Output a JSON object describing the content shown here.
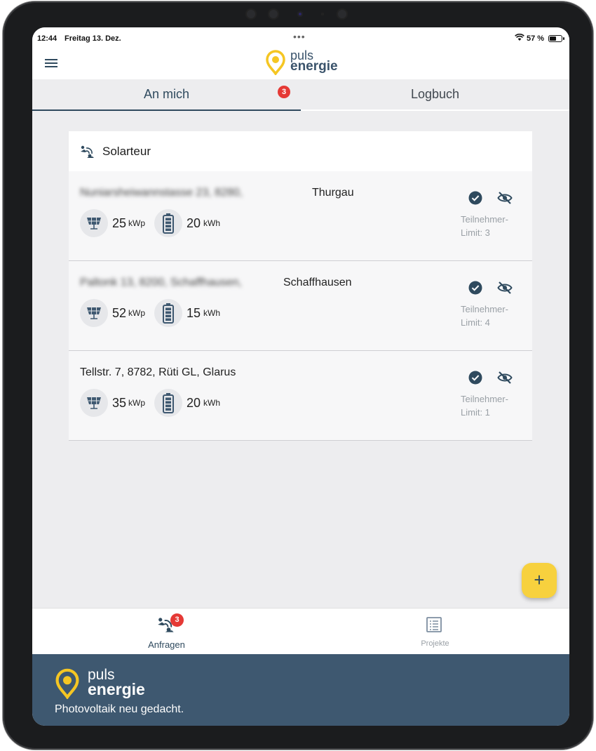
{
  "status_bar": {
    "time": "12:44",
    "date": "Freitag 13. Dez.",
    "dots": "•••",
    "battery_percent": "57 %"
  },
  "header": {
    "logo_line1": "puls",
    "logo_line2": "energie"
  },
  "tabs": [
    {
      "label": "An mich",
      "badge": "3",
      "active": true
    },
    {
      "label": "Logbuch",
      "active": false
    }
  ],
  "card": {
    "title": "Solarteur",
    "rows": [
      {
        "address": "Nuniarsheiwannstasse 23, 8280,",
        "address_blurred": true,
        "region": "Thurgau",
        "pv_value": "25",
        "pv_unit": "kWp",
        "battery_value": "20",
        "battery_unit": "kWh",
        "limit_line1": "Teilnehmer-",
        "limit_line2": "Limit: 3"
      },
      {
        "address": "Paltonk 13, 8200, Schaffhausen,",
        "address_blurred": true,
        "region": "Schaffhausen",
        "pv_value": "52",
        "pv_unit": "kWp",
        "battery_value": "15",
        "battery_unit": "kWh",
        "limit_line1": "Teilnehmer-",
        "limit_line2": "Limit: 4"
      },
      {
        "address": "Tellstr. 7, 8782, Rüti GL, Glarus",
        "address_blurred": false,
        "region": "",
        "pv_value": "35",
        "pv_unit": "kWp",
        "battery_value": "20",
        "battery_unit": "kWh",
        "limit_line1": "Teilnehmer-",
        "limit_line2": "Limit: 1"
      }
    ]
  },
  "fab": {
    "label": "+"
  },
  "bottom_nav": [
    {
      "label": "Anfragen",
      "badge": "3",
      "icon": "requests-icon",
      "active": true
    },
    {
      "label": "Projekte",
      "icon": "projects-icon",
      "active": false
    }
  ],
  "footer": {
    "logo_line1": "puls",
    "logo_line2": "energie",
    "tagline": "Photovoltaik neu gedacht."
  },
  "colors": {
    "primary": "#2f4a5e",
    "accent": "#f7d13e",
    "badge": "#e53935",
    "footer_bg": "#3e5870"
  }
}
